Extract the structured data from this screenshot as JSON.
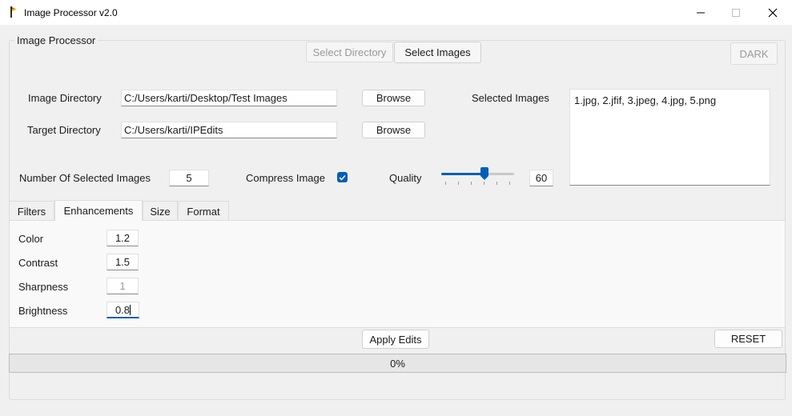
{
  "window": {
    "title": "Image Processor v2.0",
    "icons": {
      "app": "flag-icon",
      "minimize": "minimize-icon",
      "maximize": "maximize-icon",
      "close": "close-icon"
    }
  },
  "group": {
    "title": "Image Processor"
  },
  "top_buttons": {
    "select_directory": "Select Directory",
    "select_images": "Select Images",
    "dark": "DARK"
  },
  "form": {
    "image_directory_label": "Image Directory",
    "image_directory_value": "C:/Users/karti/Desktop/Test Images",
    "target_directory_label": "Target Directory",
    "target_directory_value": "C:/Users/karti/IPEdits",
    "browse_label": "Browse",
    "selected_images_label": "Selected Images",
    "selected_images_value": "1.jpg, 2.jfif, 3.jpeg, 4.jpg, 5.png",
    "num_selected_label": "Number Of Selected Images",
    "num_selected_value": "5",
    "compress_label": "Compress Image",
    "compress_checked": true,
    "quality_label": "Quality",
    "quality_value": "60",
    "quality_slider_fraction": 0.6
  },
  "tabs": [
    {
      "label": "Filters",
      "active": false
    },
    {
      "label": "Enhancements",
      "active": true
    },
    {
      "label": "Size",
      "active": false
    },
    {
      "label": "Format",
      "active": false
    }
  ],
  "enhancements": [
    {
      "label": "Color",
      "value": "1.2"
    },
    {
      "label": "Contrast",
      "value": "1.5"
    },
    {
      "label": "Sharpness",
      "value": "1"
    },
    {
      "label": "Brightness",
      "value": "0.8"
    }
  ],
  "bottom": {
    "apply_label": "Apply Edits",
    "reset_label": "RESET",
    "progress_text": "0%",
    "progress_fraction": 0
  },
  "colors": {
    "accent": "#005fb8",
    "window_bg": "#f0f0f0"
  }
}
